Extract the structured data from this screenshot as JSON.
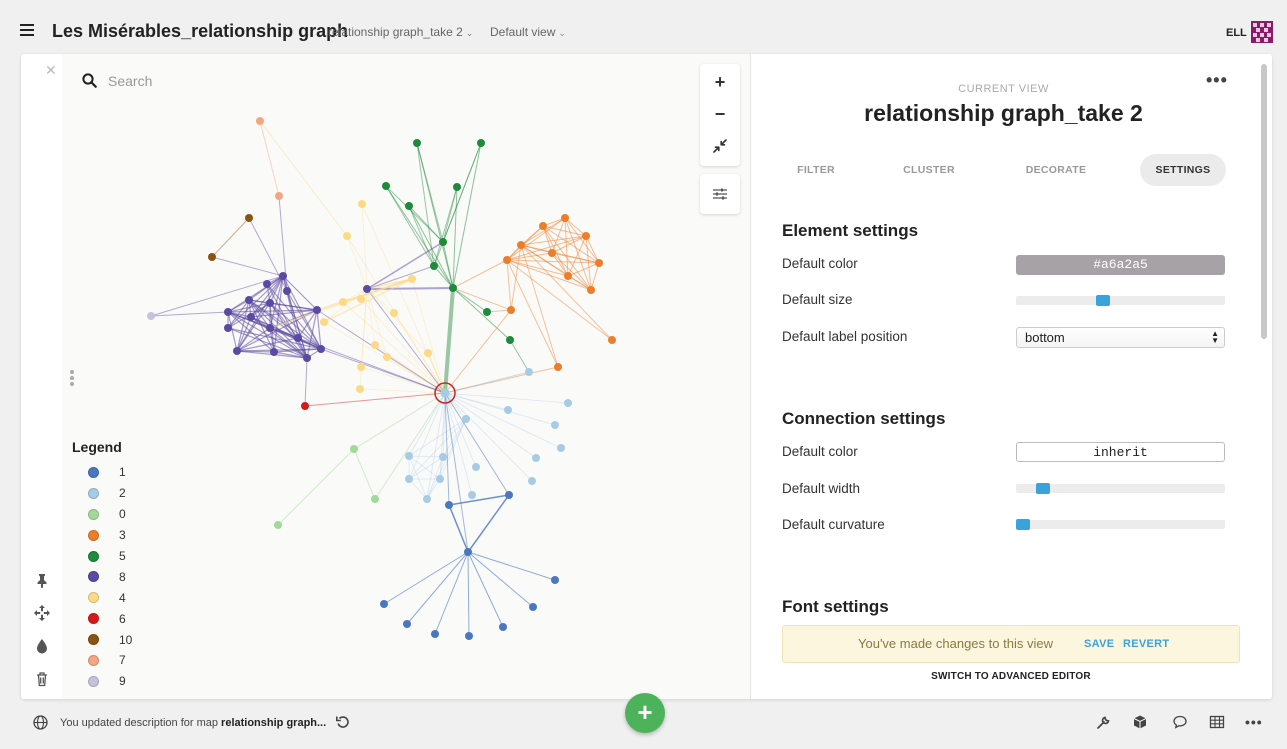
{
  "app": {
    "title": "Les Misérables_relationship graph",
    "view_menu": "relationship graph_take 2",
    "view_mode_menu": "Default view",
    "user_initials": "ELL"
  },
  "map": {
    "search_placeholder": "Search",
    "zoom_in": "+",
    "zoom_out": "−"
  },
  "legend": {
    "title": "Legend",
    "items": [
      {
        "label": "1",
        "color": "#4a77c0"
      },
      {
        "label": "2",
        "color": "#a8cbe5"
      },
      {
        "label": "0",
        "color": "#a1d99b"
      },
      {
        "label": "3",
        "color": "#ee7d2a"
      },
      {
        "label": "5",
        "color": "#1e8a3c"
      },
      {
        "label": "8",
        "color": "#5b49a2"
      },
      {
        "label": "4",
        "color": "#fdd985"
      },
      {
        "label": "6",
        "color": "#d7191c"
      },
      {
        "label": "10",
        "color": "#8c5210"
      },
      {
        "label": "7",
        "color": "#f4a582"
      },
      {
        "label": "9",
        "color": "#c6c2dd"
      }
    ]
  },
  "panel": {
    "current_view_label": "CURRENT VIEW",
    "current_view_title": "relationship graph_take 2",
    "tabs": [
      "FILTER",
      "CLUSTER",
      "DECORATE",
      "SETTINGS"
    ],
    "active_tab": "SETTINGS",
    "element_settings": {
      "title": "Element settings",
      "default_color_label": "Default color",
      "default_color_value": "#a6a2a5",
      "default_size_label": "Default size",
      "default_size_level": 0.41,
      "default_label_position_label": "Default label position",
      "default_label_position_value": "bottom"
    },
    "connection_settings": {
      "title": "Connection settings",
      "default_color_label": "Default color",
      "default_color_value": "inherit",
      "default_width_label": "Default width",
      "default_width_level": 0.1,
      "default_curvature_label": "Default curvature",
      "default_curvature_level": 0.0
    },
    "font_settings": {
      "title": "Font settings"
    },
    "notice": {
      "text": "You've made changes to this view",
      "save": "SAVE",
      "revert": "REVERT"
    },
    "advanced_editor": "SWITCH TO ADVANCED EDITOR"
  },
  "status": {
    "prefix": "You updated description for map ",
    "map_name": "relationship graph..."
  },
  "fab_label": "+",
  "colors": {
    "accent": "#3aa3dc",
    "fab": "#4cb35a"
  }
}
